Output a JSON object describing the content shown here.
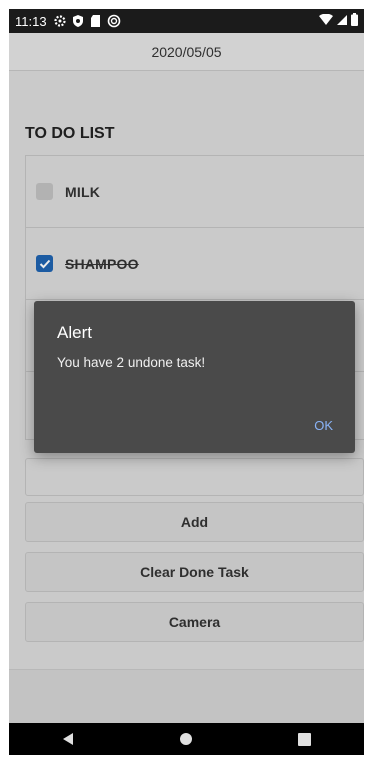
{
  "status_bar": {
    "time": "11:13",
    "left_icons": [
      "gear-icon",
      "shield-icon",
      "sd-card-icon",
      "sync-icon"
    ],
    "right_icons": [
      "wifi-icon",
      "signal-icon",
      "battery-icon"
    ]
  },
  "app_bar": {
    "title": "2020/05/05"
  },
  "list": {
    "title": "TO DO LIST",
    "items": [
      {
        "label": "MILK",
        "checked": false
      },
      {
        "label": "SHAMPOO",
        "checked": true
      }
    ]
  },
  "input": {
    "value": "",
    "placeholder": ""
  },
  "buttons": {
    "add": "Add",
    "clear_done": "Clear Done Task",
    "camera": "Camera"
  },
  "dialog": {
    "title": "Alert",
    "message": "You have 2 undone task!",
    "ok_label": "OK"
  },
  "nav_bar": {
    "icons": [
      "back-icon",
      "home-icon",
      "recents-icon"
    ]
  },
  "colors": {
    "accent": "#1f63b0",
    "dialog_bg": "#4a4a4a",
    "dialog_button": "#8ab4f8"
  }
}
